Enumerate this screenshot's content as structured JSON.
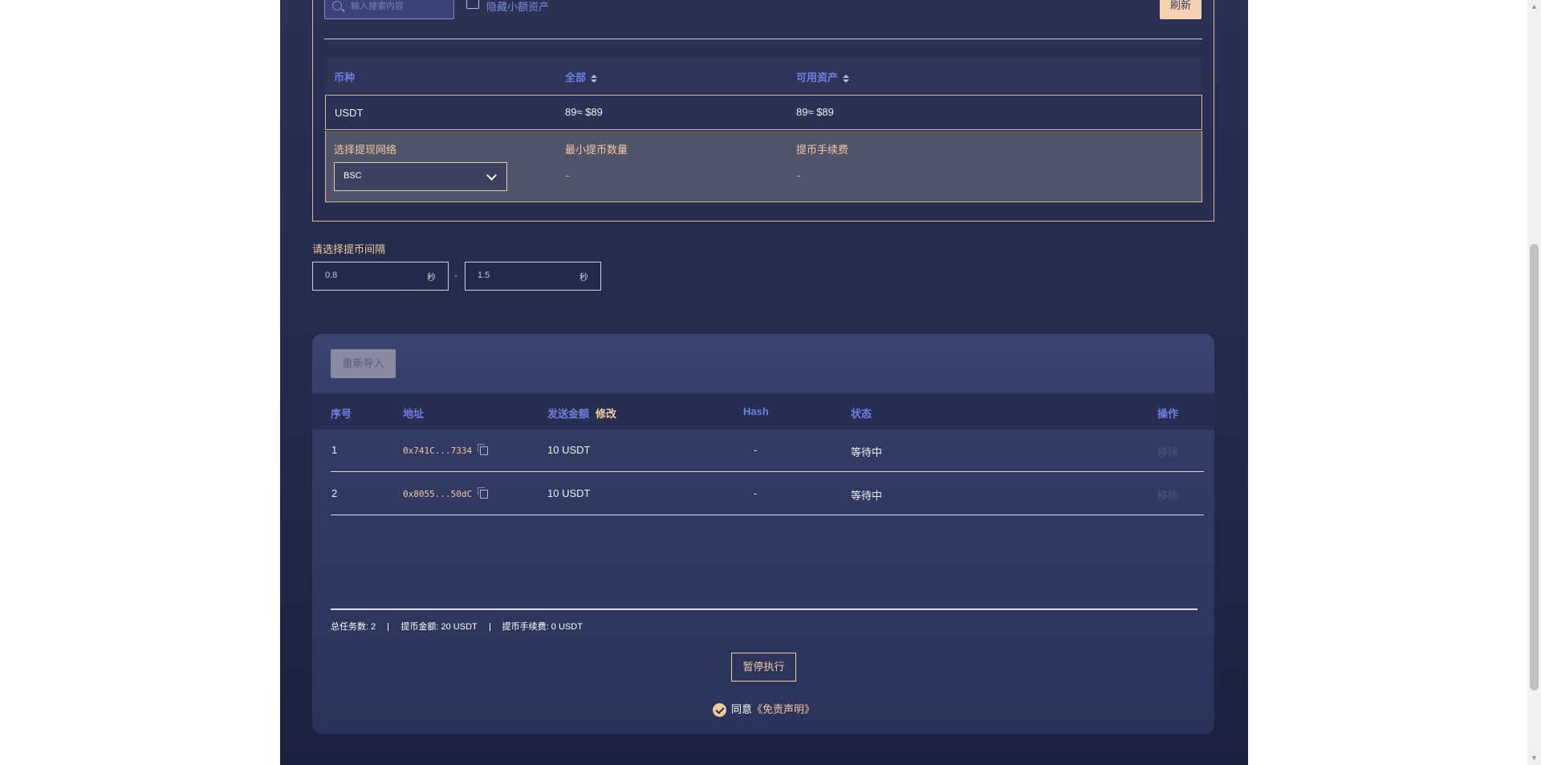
{
  "filter": {
    "search_placeholder": "输入搜索内容",
    "hide_small_label": "隐藏小额资产",
    "refresh_label": "刷新"
  },
  "asset_table": {
    "headers": [
      "币种",
      "全部",
      "可用资产"
    ],
    "row": {
      "coin": "USDT",
      "total": "89≈ $89",
      "available": "89≈ $89"
    },
    "detail": {
      "network_label": "选择提现网络",
      "network_value": "BSC",
      "min_label": "最小提币数量",
      "min_value": "-",
      "fee_label": "提币手续费",
      "fee_value": "-"
    }
  },
  "interval": {
    "label": "请选择提币间隔",
    "min_value": "0.8",
    "max_value": "1.5",
    "unit": "秒",
    "separator": "-"
  },
  "tasks": {
    "reimport_label": "重新导入",
    "headers": {
      "index": "序号",
      "address": "地址",
      "amount": "发送金额",
      "edit": "修改",
      "hash": "Hash",
      "status": "状态",
      "action": "操作"
    },
    "rows": [
      {
        "index": "1",
        "address": "0x741C...7334",
        "amount": "10 USDT",
        "hash": "-",
        "status": "等待中",
        "action": "移除"
      },
      {
        "index": "2",
        "address": "0x8055...50dC",
        "amount": "10 USDT",
        "hash": "-",
        "status": "等待中",
        "action": "移除"
      }
    ],
    "summary": {
      "total_label": "总任务数:",
      "total_value": "2",
      "amount_label": "提币金额:",
      "amount_value": "20 USDT",
      "fee_label": "提币手续费:",
      "fee_value": "0 USDT"
    },
    "pause_label": "暂停执行",
    "agree_text": "同意",
    "disclaimer_link": "《免责声明》"
  }
}
